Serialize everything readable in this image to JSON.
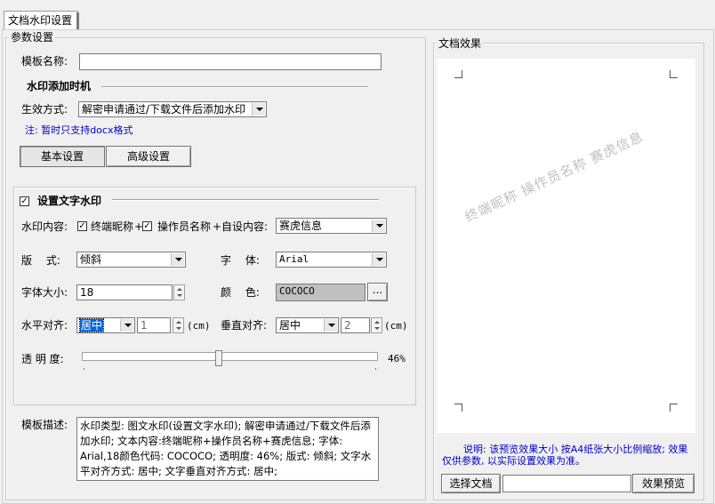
{
  "tab": {
    "label": "文档水印设置"
  },
  "params": {
    "legend": "参数设置",
    "template_name_label": "模板名称:",
    "template_name_value": "",
    "timing_heading": "水印添加时机",
    "effect_mode_label": "生效方式:",
    "effect_mode_value": "解密申请通过/下载文件后添加水印",
    "note": "注: 暂时只支持docx格式",
    "basic_tab": "基本设置",
    "advanced_tab": "高级设置"
  },
  "text_watermark": {
    "enabled": true,
    "heading": "设置文字水印",
    "content_label": "水印内容:",
    "opt_terminal": "终端昵称",
    "opt_operator": "操作员名称",
    "plus_sep": "+",
    "custom_label": "+自设内容:",
    "custom_value": "赛虎信息",
    "layout_label": "版　 式:",
    "layout_value": "倾斜",
    "font_label": "字　 体:",
    "font_value": "Arial",
    "size_label": "字体大小:",
    "size_value": "18",
    "color_label": "颜　 色:",
    "color_value": "COCOCO",
    "color_btn": "...",
    "halign_label": "水平对齐:",
    "halign_value": "居中",
    "halign_offset": "1",
    "valign_label": "垂直对齐:",
    "valign_value": "居中",
    "valign_offset": "2",
    "unit": "(cm)",
    "opacity_label": "透 明 度:",
    "opacity_text": "46%",
    "opacity_value": 0.46
  },
  "template_desc": {
    "label": "模板描述:",
    "value": "水印类型: 图文水印(设置文字水印); 解密申请通过/下载文件后添加水印; 文本内容:终端昵称+操作员名称+赛虎信息; 字体: Arial,18颜色代码: COCOCO; 透明度: 46%; 版式: 倾斜; 文字水平对齐方式: 居中; 文字垂直对齐方式: 居中;"
  },
  "preview": {
    "legend": "文档效果",
    "watermark_text": "终端昵称 操作员名称 赛虎信息",
    "watermark_color": "#c0c0c0",
    "info": "说明: 该预览效果大小 按A4纸张大小比例缩放; 效果仅供参数, 以实际设置效果为准。",
    "select_doc_btn": "选择文档",
    "doc_path": "",
    "preview_btn": "效果预览"
  }
}
